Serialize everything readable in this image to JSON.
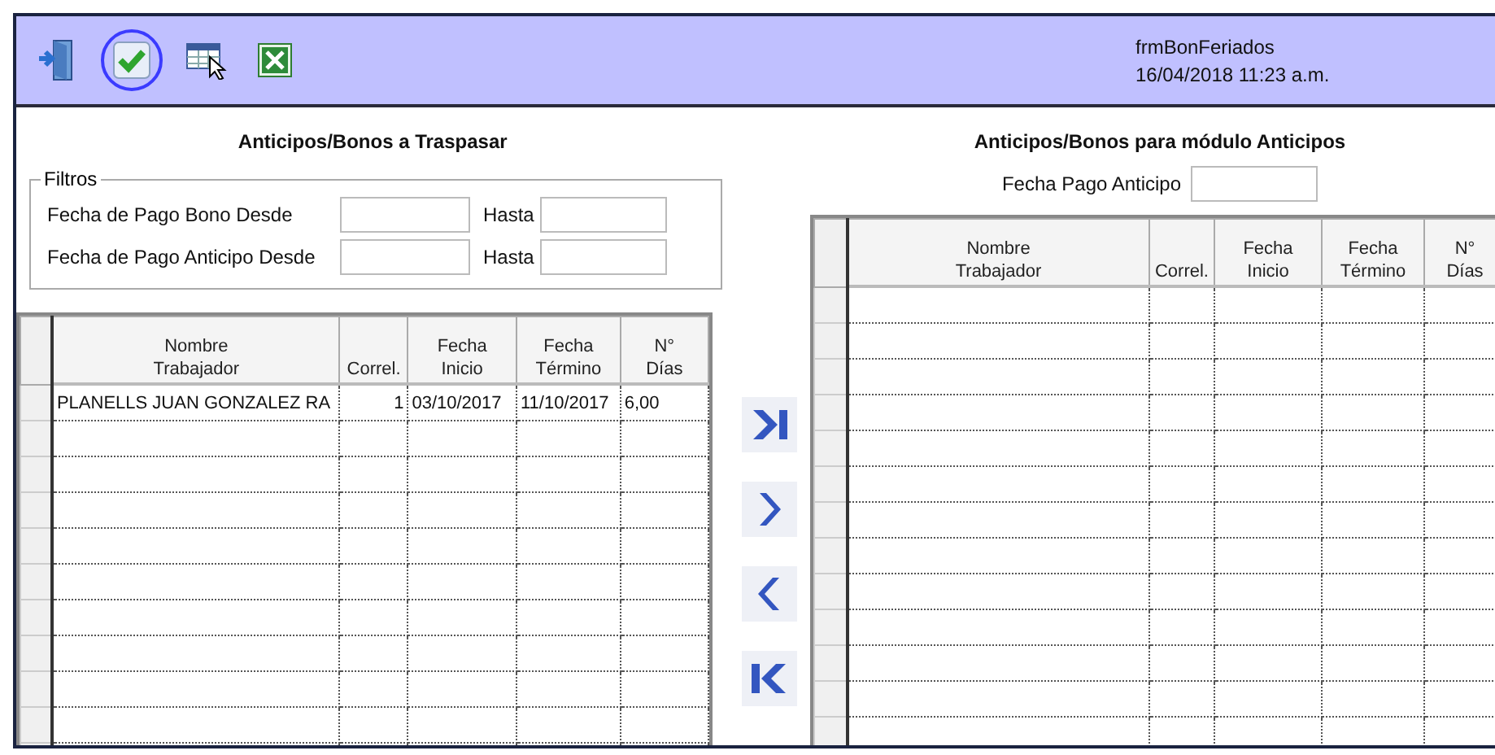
{
  "toolbar": {
    "buttons": [
      {
        "kind": "exit",
        "selected": false
      },
      {
        "kind": "accept",
        "selected": true
      },
      {
        "kind": "grid",
        "selected": false
      },
      {
        "kind": "excel",
        "selected": false
      }
    ],
    "form_name": "frmBonFeriados",
    "datetime": "16/04/2018 11:23 a.m."
  },
  "left": {
    "title": "Anticipos/Bonos a Traspasar",
    "filter_group": "Filtros",
    "filters": [
      {
        "label": "Fecha de Pago Bono Desde",
        "to_label": "Hasta"
      },
      {
        "label": "Fecha de Pago Anticipo Desde",
        "to_label": "Hasta"
      }
    ],
    "columns": [
      {
        "top": "Nombre",
        "bottom": "Trabajador"
      },
      {
        "bottom": "Correl."
      },
      {
        "top": "Fecha",
        "bottom": "Inicio"
      },
      {
        "top": "Fecha",
        "bottom": "Término"
      },
      {
        "top": "N°",
        "bottom": "Días"
      }
    ],
    "rows": [
      [
        "PLANELLS JUAN GONZALEZ RA",
        "1",
        "03/10/2017",
        "11/10/2017",
        "6,00"
      ]
    ]
  },
  "transfer_buttons": [
    {
      "kind": "last"
    },
    {
      "kind": "next"
    },
    {
      "kind": "prev"
    },
    {
      "kind": "first"
    }
  ],
  "right": {
    "title": "Anticipos/Bonos para módulo Anticipos",
    "field_label": "Fecha Pago Anticipo",
    "columns": [
      {
        "top": "Nombre",
        "bottom": "Trabajador"
      },
      {
        "bottom": "Correl."
      },
      {
        "top": "Fecha",
        "bottom": "Inicio"
      },
      {
        "top": "Fecha",
        "bottom": "Término"
      },
      {
        "top": "N°",
        "bottom": "Días"
      }
    ]
  }
}
